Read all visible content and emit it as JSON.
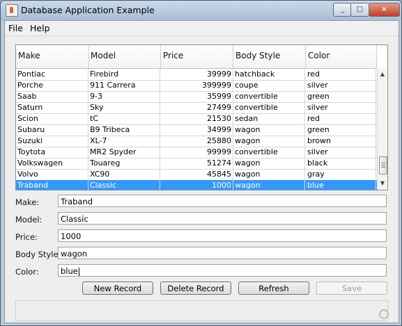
{
  "window": {
    "title": "Database Application Example",
    "minimize": "_",
    "maximize": "□",
    "close": "×"
  },
  "menu": [
    "File",
    "Help"
  ],
  "table": {
    "columns": [
      "Make",
      "Model",
      "Price",
      "Body Style",
      "Color"
    ],
    "rows": [
      [
        "Pontiac",
        "Firebird",
        "39999",
        "hatchback",
        "red"
      ],
      [
        "Porche",
        "911 Carrera",
        "399999",
        "coupe",
        "silver"
      ],
      [
        "Saab",
        "9-3",
        "35999",
        "convertible",
        "green"
      ],
      [
        "Saturn",
        "Sky",
        "27499",
        "convertible",
        "silver"
      ],
      [
        "Scion",
        "tC",
        "21530",
        "sedan",
        "red"
      ],
      [
        "Subaru",
        "B9 Tribeca",
        "34999",
        "wagon",
        "green"
      ],
      [
        "Suzuki",
        "XL-7",
        "25880",
        "wagon",
        "brown"
      ],
      [
        "Toytota",
        "MR2 Spyder",
        "99999",
        "convertible",
        "silver"
      ],
      [
        "Volkswagen",
        "Touareg",
        "51274",
        "wagon",
        "black"
      ],
      [
        "Volvo",
        "XC90",
        "45845",
        "wagon",
        "gray"
      ],
      [
        "Traband",
        "Classic",
        "1000",
        "wagon",
        "blue"
      ]
    ],
    "selected_row": 10
  },
  "form": {
    "labels": [
      "Make:",
      "Model:",
      "Price:",
      "Body Style:",
      "Color:"
    ],
    "values": [
      "Traband",
      "Classic",
      "1000",
      "wagon",
      "blue"
    ]
  },
  "buttons": [
    "New Record",
    "Delete Record",
    "Refresh",
    "Save"
  ],
  "icons": {
    "app": "java-cup-icon",
    "resize": "resize-grip-icon",
    "scroll_up": "chevron-up-icon",
    "scroll_down": "chevron-down-icon"
  }
}
